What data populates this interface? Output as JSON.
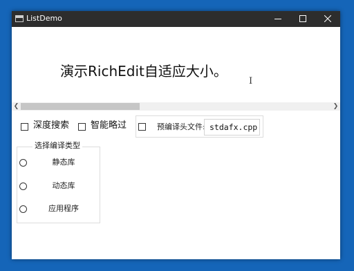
{
  "window": {
    "title": "ListDemo"
  },
  "richedit": {
    "text": "演示RichEdit自适应大小。"
  },
  "options": {
    "deep_search": "深度搜索",
    "smart_skip": "智能略过",
    "precompiled_header_label": "预编译头文件:",
    "precompiled_header_value": "stdafx.cpp"
  },
  "compile_type": {
    "title": "选择编译类型",
    "items": [
      {
        "label": "静态库"
      },
      {
        "label": "动态库"
      },
      {
        "label": "应用程序"
      }
    ]
  },
  "icons": {
    "scroll_left": "chevron-left-icon",
    "scroll_right": "chevron-right-icon",
    "minimize": "minimize-icon",
    "maximize": "maximize-icon",
    "close": "close-icon"
  }
}
